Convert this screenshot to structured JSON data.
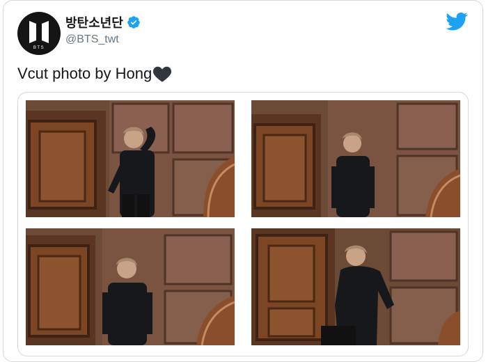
{
  "tweet": {
    "display_name": "방탄소년단",
    "handle": "@BTS_twt",
    "verified_icon": "verified-badge-icon",
    "text": "Vcut photo by Hong",
    "emoji": "black-heart"
  },
  "avatar": {
    "logo_text": "BTS"
  },
  "colors": {
    "twitter_blue": "#1da1f2",
    "text_primary": "#14171a",
    "text_secondary": "#657786",
    "border": "#cfd9de"
  },
  "media": {
    "photos": [
      {
        "label": "photo-1"
      },
      {
        "label": "photo-2"
      },
      {
        "label": "photo-3"
      },
      {
        "label": "photo-4"
      }
    ]
  }
}
